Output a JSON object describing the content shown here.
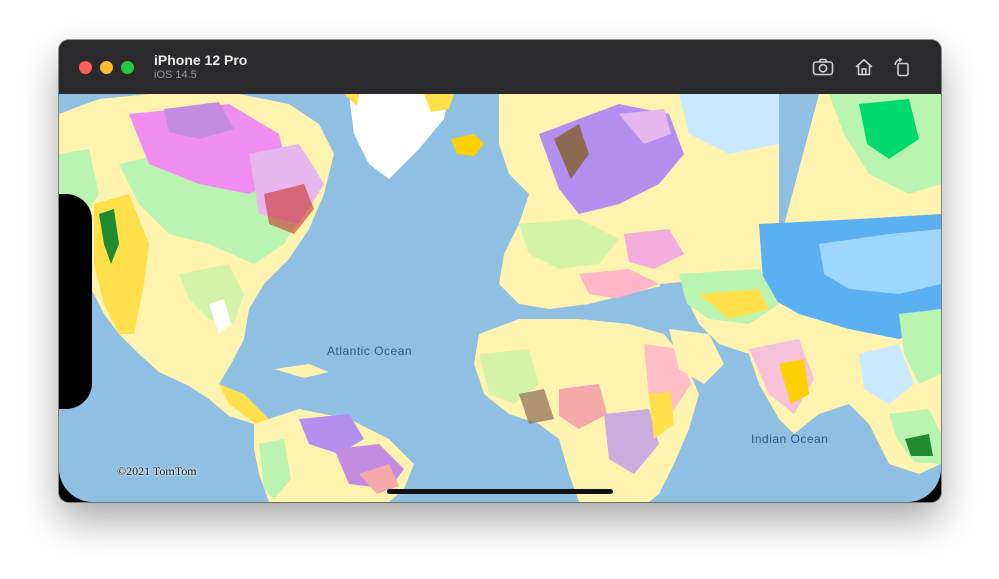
{
  "window": {
    "device_name": "iPhone 12 Pro",
    "os_version": "iOS 14.5"
  },
  "toolbar": {
    "screenshot_icon": "camera-icon",
    "home_icon": "home-icon",
    "rotate_icon": "rotate-icon"
  },
  "map": {
    "labels": {
      "atlantic": "Atlantic Ocean",
      "indian": "Indian Ocean"
    },
    "copyright": "©2021 TomTom",
    "colors": {
      "ocean": "#8fbfe3",
      "land_light": "#fff3b0",
      "land_green": "#b9f5b0",
      "greenland": "#ffffff"
    }
  }
}
